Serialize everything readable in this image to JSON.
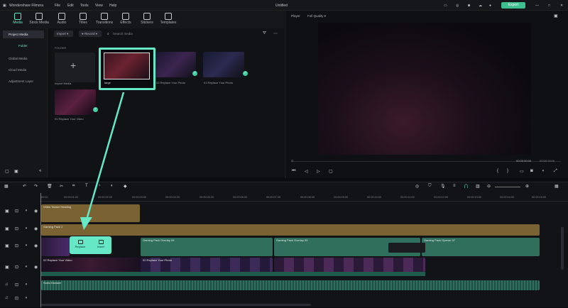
{
  "app": {
    "name": "Wondershare Filmora",
    "menus": [
      "File",
      "Edit",
      "Tools",
      "View",
      "Help"
    ],
    "doc_title": "Untitled",
    "export_label": "Export"
  },
  "toolbar": {
    "items": [
      "Media",
      "Stock Media",
      "Audio",
      "Titles",
      "Transitions",
      "Effects",
      "Stickers",
      "Templates"
    ],
    "active": "Media"
  },
  "sidebar": {
    "items": [
      "Project Media",
      "Folder",
      "Global Media",
      "Cloud Media",
      "Adjustment Layer"
    ]
  },
  "media": {
    "import_label": "Import",
    "record_label": "Record",
    "search_placeholder": "Search media",
    "folder_label": "FOLDER",
    "import_tile_label": "Import Media",
    "items": [
      {
        "caption": "large",
        "selected": true
      },
      {
        "caption": "02 Replace Your Photo"
      },
      {
        "caption": "01 Replace Your Photo"
      },
      {
        "caption": "01 Replace Your Video"
      }
    ]
  },
  "player": {
    "label": "Player",
    "quality": "Full Quality",
    "time_current": "00:00:00:00",
    "time_total": "00:00:15:00"
  },
  "timeline": {
    "ruler": [
      "00:00",
      "00:00:01:00",
      "00:00:02:00",
      "00:00:03:00",
      "00:00:04:00",
      "00:00:05:00",
      "00:00:06:00",
      "00:00:07:00",
      "00:00:08:00",
      "00:00:09:00",
      "00:00:10:00",
      "00:00:11:00",
      "00:00:12:00",
      "00:00:13:00",
      "00:00:14:00",
      "00:00:15:00"
    ],
    "clips": {
      "title_clip": "Video Teaser Heading",
      "text_clip": "Gaming Pack 2",
      "overlay_a": "Gaming Pack Overlay 06",
      "overlay_b": "Gaming Pack Overlay 05",
      "overlay_c": "Gaming Pack Opener 07",
      "video_a": "02 Replace Your Video",
      "video_b": "02 Replace Your Photo",
      "audio": "Sonic Breaker"
    },
    "tooltip": {
      "replace": "Replace",
      "insert": "Insert"
    }
  },
  "colors": {
    "accent": "#66e7c6",
    "export_btn": "#3fc08f",
    "yellow_track": "#7a6232",
    "teal_track": "#2f6f5c"
  }
}
